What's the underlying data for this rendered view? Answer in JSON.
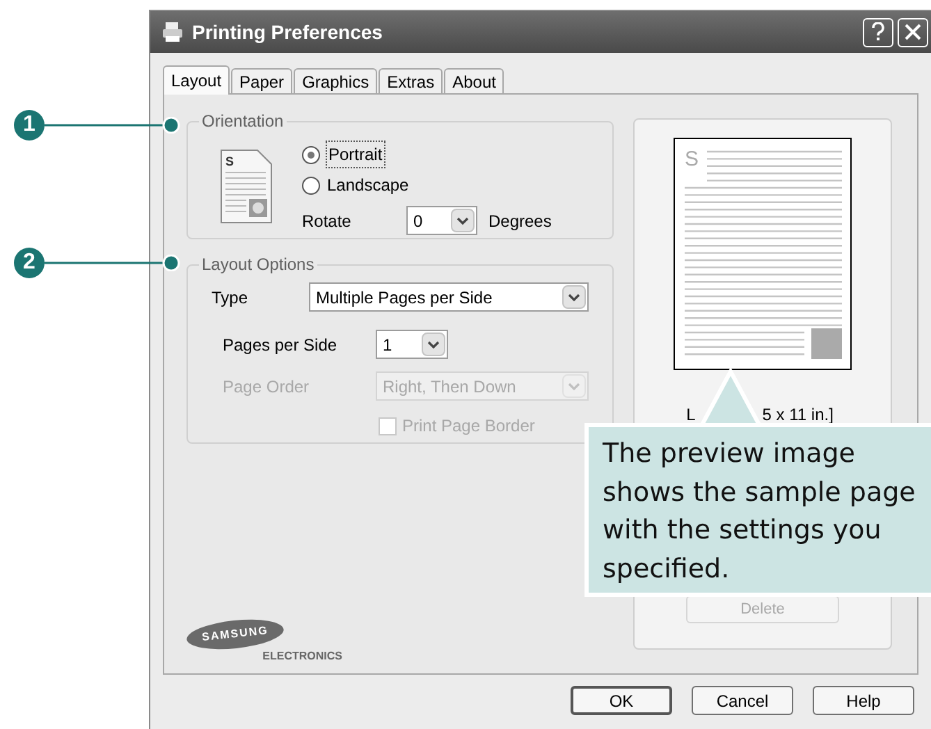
{
  "callouts": [
    {
      "number": "1"
    },
    {
      "number": "2"
    }
  ],
  "window": {
    "title": "Printing Preferences"
  },
  "tabs": [
    {
      "label": "Layout",
      "selected": true
    },
    {
      "label": "Paper",
      "selected": false
    },
    {
      "label": "Graphics",
      "selected": false
    },
    {
      "label": "Extras",
      "selected": false
    },
    {
      "label": "About",
      "selected": false
    }
  ],
  "orientation": {
    "title": "Orientation",
    "icon_letter": "S",
    "options": [
      {
        "label": "Portrait",
        "selected": true
      },
      {
        "label": "Landscape",
        "selected": false
      }
    ],
    "rotate": {
      "label": "Rotate",
      "value": "0",
      "unit": "Degrees"
    }
  },
  "layout_options": {
    "title": "Layout Options",
    "rows": [
      {
        "kind": "select",
        "label": "Type",
        "value": "Multiple Pages per Side",
        "disabled": false,
        "wide": true
      },
      {
        "kind": "select",
        "label": "Pages per Side",
        "value": "1",
        "disabled": false,
        "wide": false
      },
      {
        "kind": "select",
        "label": "Page Order",
        "value": "Right, Then Down",
        "disabled": true,
        "wide": true
      },
      {
        "kind": "checkbox",
        "label": "Print Page Border",
        "checked": false,
        "disabled": true
      }
    ]
  },
  "logo": {
    "name": "SAMSUNG",
    "sub": "ELECTRONICS"
  },
  "preview": {
    "page_letter": "S",
    "label_start": "L",
    "label_end": "5 x 11 in.]",
    "delete_button": {
      "label": "Delete",
      "disabled": true
    }
  },
  "tooltip": {
    "text": "The preview image shows the sample page with the settings you specified."
  },
  "buttons": [
    {
      "label": "OK",
      "default": true
    },
    {
      "label": "Cancel",
      "default": false
    },
    {
      "label": "Help",
      "default": false
    }
  ]
}
